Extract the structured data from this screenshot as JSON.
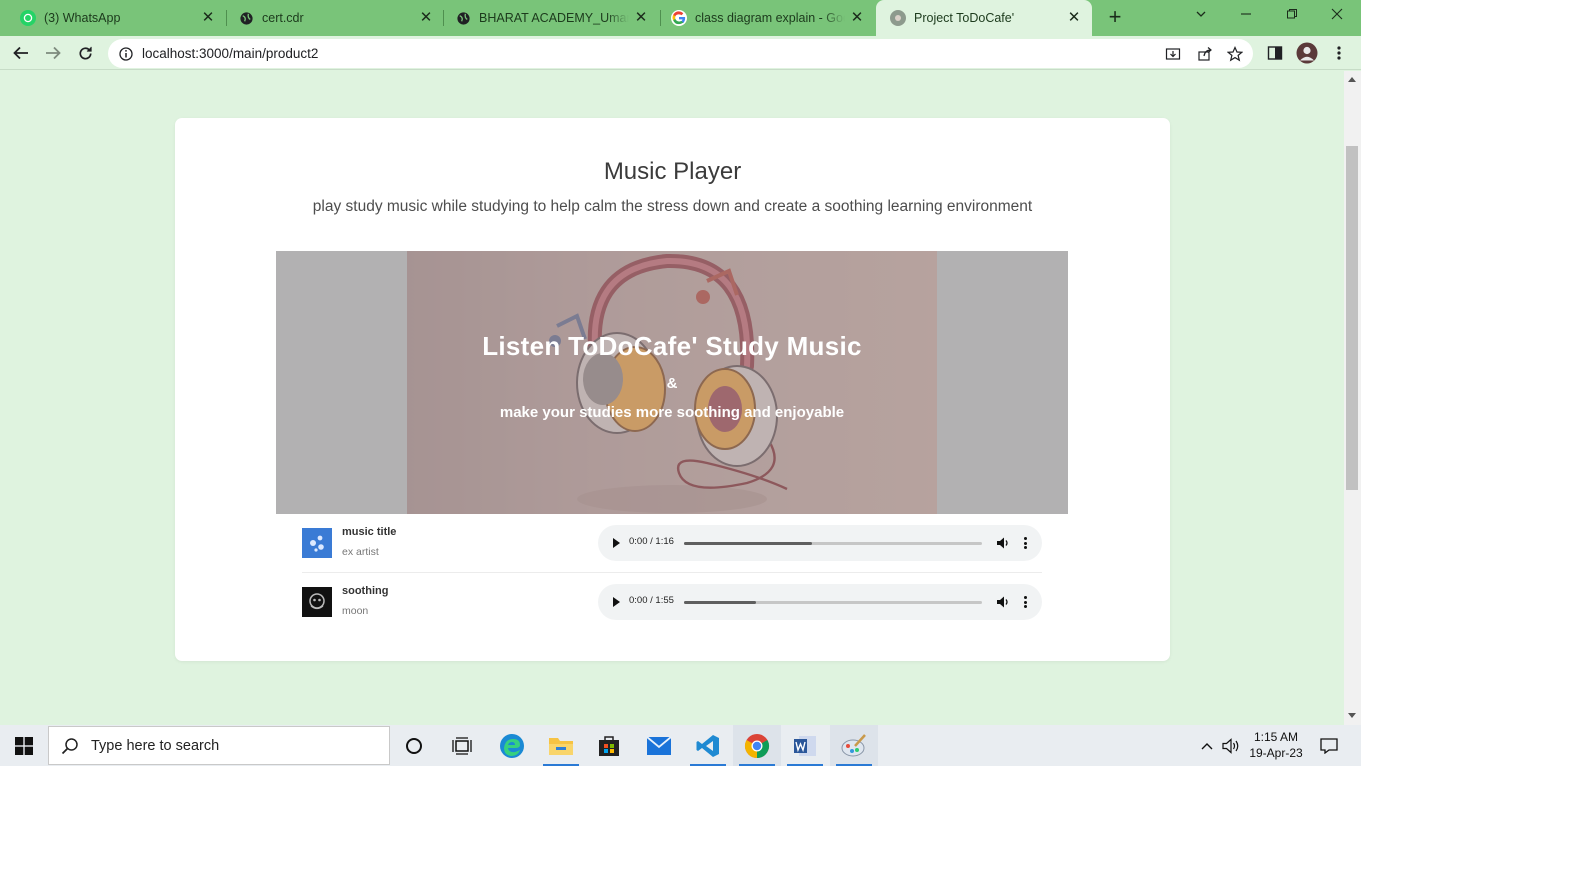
{
  "browser": {
    "tabs": [
      {
        "title": "(3) WhatsApp",
        "icon": "whatsapp-icon",
        "active": false
      },
      {
        "title": "cert.cdr",
        "icon": "globe-icon",
        "active": false
      },
      {
        "title": "BHARAT ACADEMY_Umang S",
        "icon": "globe-icon",
        "active": false
      },
      {
        "title": "class diagram explain - Goog",
        "icon": "google-icon",
        "active": false
      },
      {
        "title": "Project ToDoCafe'",
        "icon": "todocafe-icon",
        "active": true
      }
    ],
    "url": "localhost:3000/main/product2"
  },
  "page": {
    "title": "Music Player",
    "subtitle": "play study music while studying to help calm the stress down and create a soothing learning environment",
    "hero": {
      "headline": "Listen ToDoCafe' Study Music",
      "amp": "&",
      "tagline": "make your studies more soothing and enjoyable"
    },
    "tracks": [
      {
        "title": "music title",
        "artist": "ex artist",
        "time": "0:00 / 1:16",
        "progress": 0.43
      },
      {
        "title": "soothing",
        "artist": "moon",
        "time": "0:00 / 1:55",
        "progress": 0.24
      }
    ]
  },
  "taskbar": {
    "search_placeholder": "Type here to search",
    "time": "1:15 AM",
    "date": "19-Apr-23"
  },
  "colors": {
    "tab_strip": "#79c479",
    "page_bg": "#dff3df",
    "card_bg": "#ffffff",
    "hero_bg": "#b2b1b2"
  }
}
